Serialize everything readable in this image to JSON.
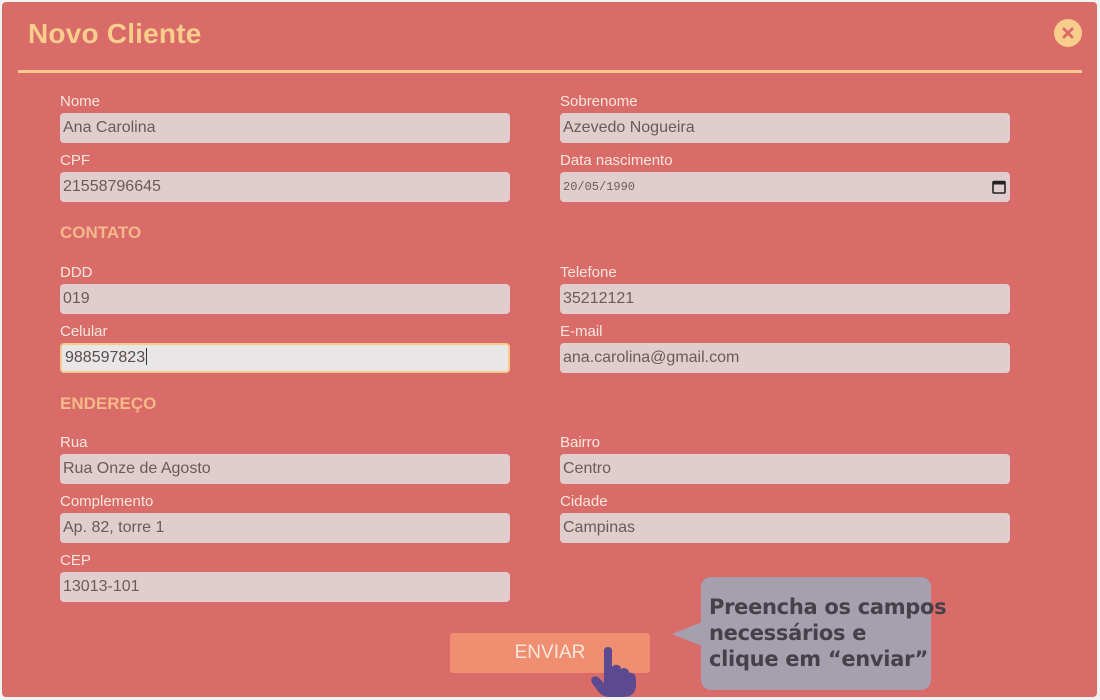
{
  "modal": {
    "title": "Novo Cliente"
  },
  "personal": {
    "nome": {
      "label": "Nome",
      "value": "Ana Carolina"
    },
    "sobrenome": {
      "label": "Sobrenome",
      "value": "Azevedo Nogueira"
    },
    "cpf": {
      "label": "CPF",
      "value": "21558796645"
    },
    "nascimento": {
      "label": "Data nascimento",
      "value": "20/05/1990"
    }
  },
  "contato": {
    "title": "CONTATO",
    "ddd": {
      "label": "DDD",
      "value": "019"
    },
    "telefone": {
      "label": "Telefone",
      "value": "35212121"
    },
    "celular": {
      "label": "Celular",
      "value": "988597823"
    },
    "email": {
      "label": "E-mail",
      "value": "ana.carolina@gmail.com"
    }
  },
  "endereco": {
    "title": "ENDEREÇO",
    "rua": {
      "label": "Rua",
      "value": "Rua Onze de Agosto"
    },
    "bairro": {
      "label": "Bairro",
      "value": "Centro"
    },
    "complemento": {
      "label": "Complemento",
      "value": "Ap. 82, torre 1"
    },
    "cidade": {
      "label": "Cidade",
      "value": "Campinas"
    },
    "cep": {
      "label": "CEP",
      "value": "13013-101"
    }
  },
  "submit": {
    "label": "ENVIAR"
  },
  "tooltip": {
    "lines": [
      "Preencha os campos",
      "necessários e",
      "clique em “enviar”"
    ]
  },
  "icons": {
    "close": "close-icon",
    "calendar": "calendar-icon",
    "pointer": "pointing-hand-icon"
  },
  "colors": {
    "modal_background": "#d96b69",
    "accent": "#f9cd8c",
    "input_background": "#e1cdcd",
    "submit_background": "#ef8e70",
    "tooltip_background": "#a59fae",
    "hand_icon": "#5b4a8f"
  }
}
